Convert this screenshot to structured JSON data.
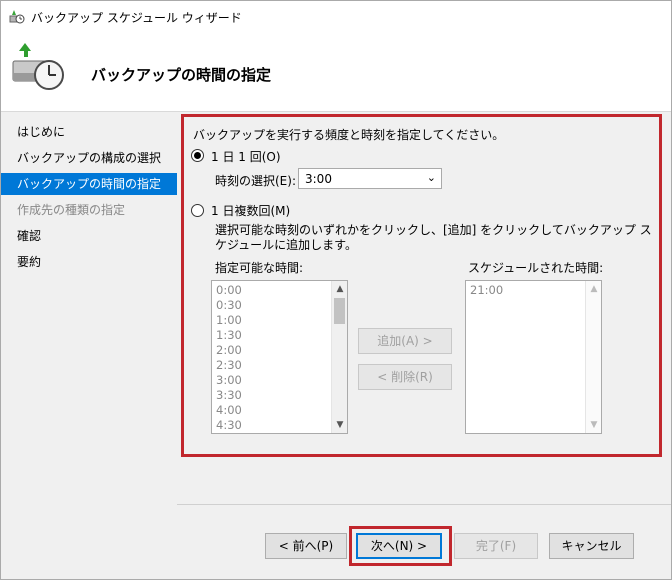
{
  "window": {
    "title": "バックアップ スケジュール ウィザード"
  },
  "header": {
    "title": "バックアップの時間の指定"
  },
  "nav": {
    "items": [
      {
        "label": "はじめに",
        "state": "normal"
      },
      {
        "label": "バックアップの構成の選択",
        "state": "normal"
      },
      {
        "label": "バックアップの時間の指定",
        "state": "active"
      },
      {
        "label": "作成先の種類の指定",
        "state": "disabled"
      },
      {
        "label": "確認",
        "state": "normal"
      },
      {
        "label": "要約",
        "state": "normal"
      }
    ]
  },
  "content": {
    "instruction": "バックアップを実行する頻度と時刻を指定してください。",
    "once_daily": {
      "label": "1 日 1 回(O)",
      "checked": true
    },
    "time_select": {
      "label": "時刻の選択(E):",
      "value": "3:00"
    },
    "multiple_daily": {
      "label": "1 日複数回(M)",
      "checked": false
    },
    "multi_description": "選択可能な時刻のいずれかをクリックし、[追加] をクリックしてバックアップ スケジュールに追加します。",
    "available_times": {
      "label": "指定可能な時間:",
      "items": [
        "0:00",
        "0:30",
        "1:00",
        "1:30",
        "2:00",
        "2:30",
        "3:00",
        "3:30",
        "4:00",
        "4:30"
      ]
    },
    "scheduled_times": {
      "label": "スケジュールされた時間:",
      "items": [
        "21:00"
      ]
    },
    "add_button": "追加(A) >",
    "remove_button": "< 削除(R)"
  },
  "footer": {
    "back": "< 前へ(P)",
    "next": "次へ(N) >",
    "finish": "完了(F)",
    "cancel": "キャンセル"
  },
  "colors": {
    "accent": "#0078d7",
    "highlight_border": "#c1272d",
    "panel": "#f0f0f0"
  }
}
